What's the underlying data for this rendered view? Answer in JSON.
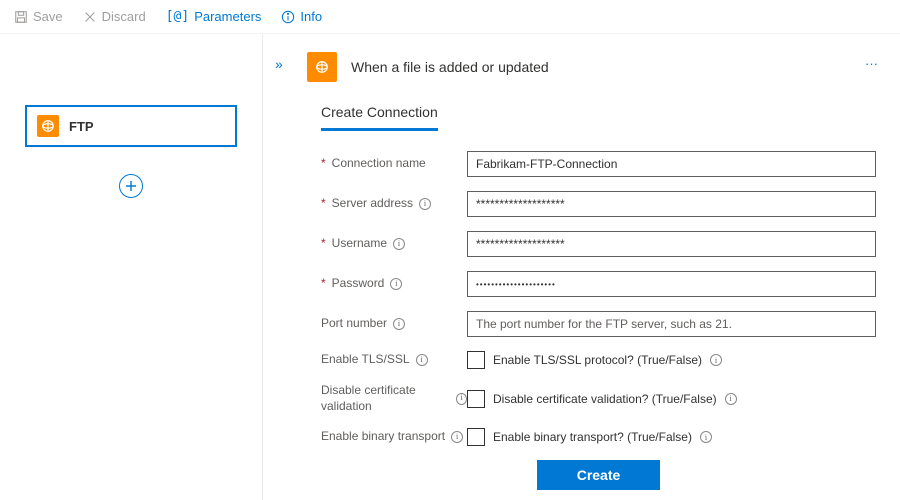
{
  "toolbar": {
    "save": "Save",
    "discard": "Discard",
    "parameters": "Parameters",
    "info": "Info"
  },
  "canvas": {
    "node_title": "FTP"
  },
  "panel": {
    "title": "When a file is added or updated",
    "section": "Create Connection",
    "labels": {
      "conn_name": "Connection name",
      "server": "Server address",
      "username": "Username",
      "password": "Password",
      "port": "Port number",
      "tls": "Enable TLS/SSL",
      "cert": "Disable certificate validation",
      "binary": "Enable binary transport"
    },
    "values": {
      "conn_name": "Fabrikam-FTP-Connection",
      "server": "*******************",
      "username": "*******************",
      "password": "•••••••••••••••••••••"
    },
    "placeholders": {
      "port": "The port number for the FTP server, such as 21."
    },
    "checks": {
      "tls": "Enable TLS/SSL protocol? (True/False)",
      "cert": "Disable certificate validation? (True/False)",
      "binary": "Enable binary transport? (True/False)"
    },
    "create_btn": "Create"
  }
}
